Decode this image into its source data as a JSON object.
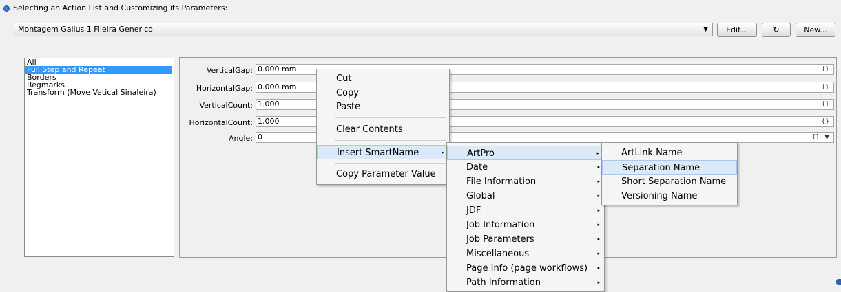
{
  "header": {
    "title": "Selecting an Action List and Customizing its Parameters:",
    "action_list_value": "Montagem Gallus 1 Fileira Generico",
    "edit_label": "Edit...",
    "refresh_label": "↻",
    "new_label": "New..."
  },
  "list": {
    "items": [
      "All",
      "Full Step and Repeat",
      "Borders",
      "Regmarks",
      "Transform (Move Vetical Sinaleira)"
    ]
  },
  "params": [
    {
      "label": "VerticalGap:",
      "value": "0.000 mm"
    },
    {
      "label": "HorizontalGap:",
      "value": "0.000 mm"
    },
    {
      "label": "VerticalCount:",
      "value": "1.000"
    },
    {
      "label": "HorizontalCount:",
      "value": "1.000"
    },
    {
      "label": "Angle:",
      "value": "0"
    }
  ],
  "param_braces": "{}",
  "context_menu": {
    "items": [
      "Cut",
      "Copy",
      "Paste",
      "Clear Contents",
      "Insert SmartName",
      "Copy Parameter Value"
    ]
  },
  "smartname_menu": {
    "items": [
      "ArtPro",
      "Date",
      "File Information",
      "Global",
      "JDF",
      "Job Information",
      "Job Parameters",
      "Miscellaneous",
      "Page Info (page workflows)",
      "Path Information"
    ]
  },
  "artpro_menu": {
    "items": [
      "ArtLink Name",
      "Separation Name",
      "Short Separation Name",
      "Versioning Name"
    ]
  },
  "icons": {
    "submenu_arrow": "▸",
    "dropdown_arrow": "▼"
  }
}
